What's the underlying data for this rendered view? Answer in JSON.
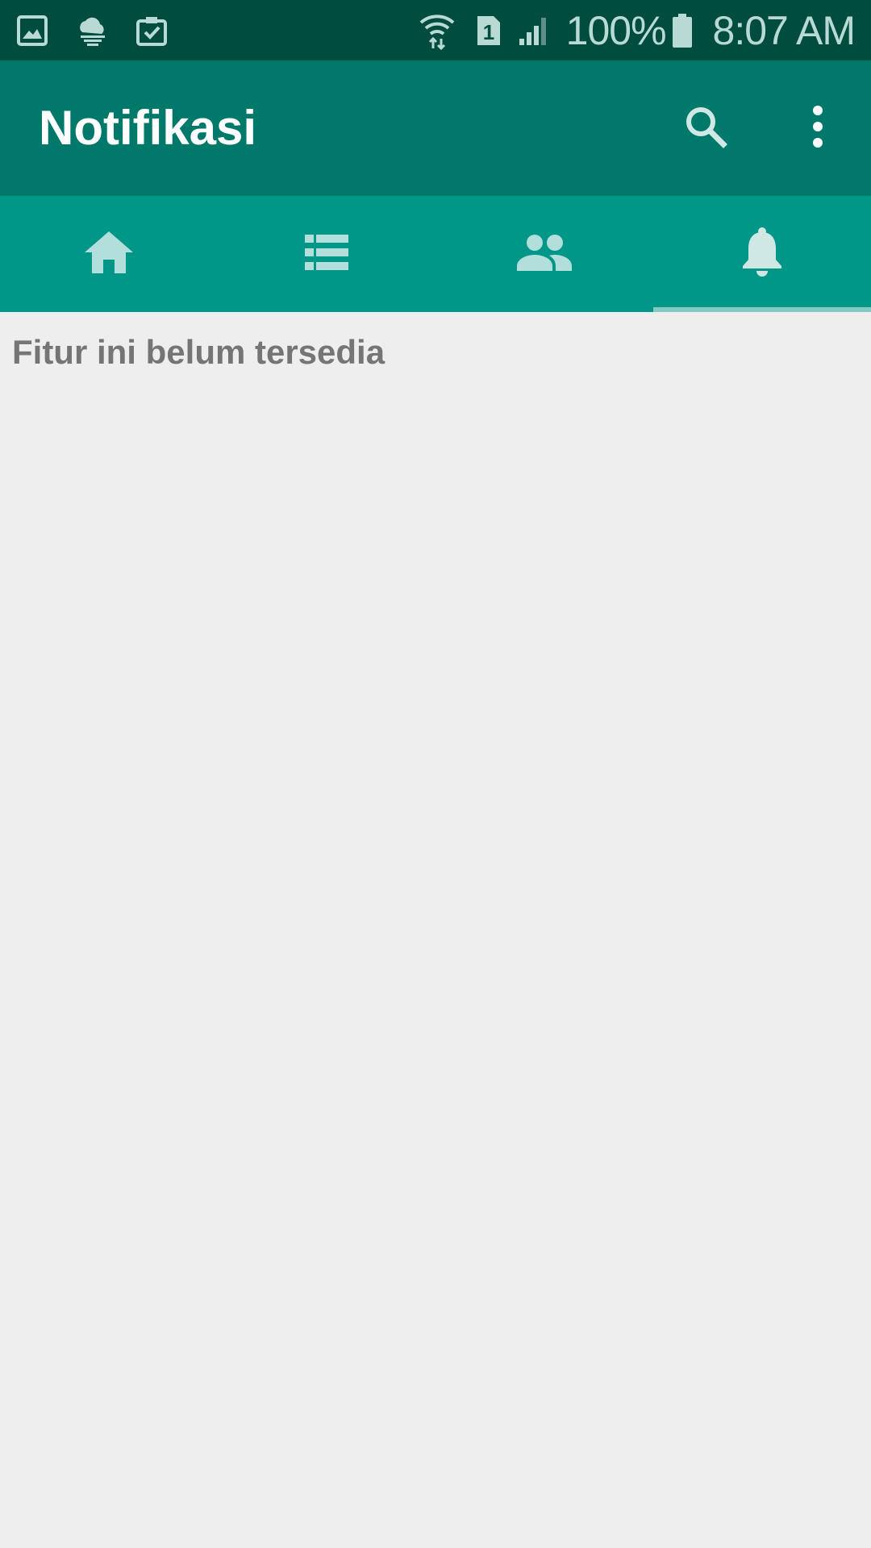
{
  "status_bar": {
    "left_icons": [
      "gallery-icon",
      "cloud-icon",
      "clipboard-check-icon"
    ],
    "right_icons": [
      "wifi-icon",
      "sim-1-icon",
      "signal-icon",
      "battery-icon"
    ],
    "battery_text": "100%",
    "time": "8:07 AM"
  },
  "toolbar": {
    "title": "Notifikasi",
    "actions": [
      "search-icon",
      "more-vert-icon"
    ]
  },
  "tabs": [
    {
      "icon": "home-icon",
      "selected": false
    },
    {
      "icon": "list-icon",
      "selected": false
    },
    {
      "icon": "people-icon",
      "selected": false
    },
    {
      "icon": "bell-icon",
      "selected": true
    }
  ],
  "content": {
    "message": "Fitur ini belum tersedia"
  },
  "colors": {
    "status_bar": "#004d40",
    "toolbar": "#00796b",
    "tabbar": "#009688",
    "tab_icon": "#b2dfdb",
    "tab_indicator": "#80cbc4",
    "background": "#eeeeee",
    "message_text": "#757575"
  }
}
